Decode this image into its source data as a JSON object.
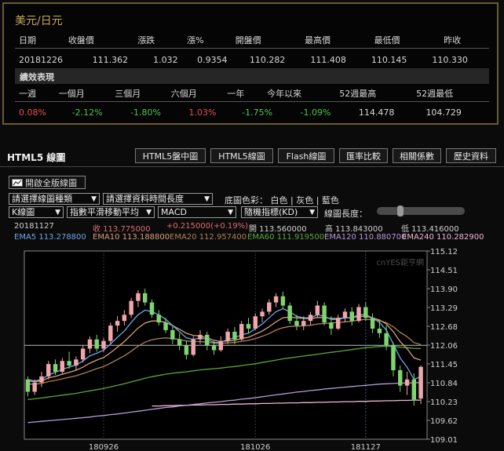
{
  "quote": {
    "title": "美元/日元",
    "headers": [
      "日期",
      "收盤價",
      "漲跌",
      "漲%",
      "開盤價",
      "最高價",
      "最低價",
      "昨收"
    ],
    "values": [
      "20181226",
      "111.362",
      "1.032",
      "0.9354",
      "110.282",
      "111.408",
      "110.145",
      "110.330"
    ],
    "perf_title": "績效表現",
    "perf_headers": [
      "一週",
      "一個月",
      "三個月",
      "六個月",
      "一年",
      "今年以來",
      "52週最高",
      "52週最低"
    ],
    "perf_values": [
      "0.08%",
      "-2.12%",
      "-1.80%",
      "1.03%",
      "-1.75%",
      "-1.09%",
      "114.478",
      "104.729"
    ]
  },
  "section": {
    "title": "HTML5 線圖",
    "tabs": [
      "HTML5盤中圖",
      "HTML5線圖",
      "Flash線圖",
      "匯率比較",
      "相關係數",
      "歷史資料"
    ]
  },
  "controls": {
    "full_button": "開啟全版線圖",
    "chart_type": "請選擇線圖種類",
    "time_length": "請選擇資料時間長度",
    "bg_label": "底圖色彩：",
    "bg_white": "白色",
    "bg_gray": "灰色",
    "bg_blue": "藍色",
    "sep": "|",
    "k_chart": "K線圖",
    "ma": "指數平滑移動平均",
    "macd": "MACD",
    "indicator": "隨機指標(KD)",
    "length_label": "線圖長度：",
    "length_level": 0.25
  },
  "info": {
    "date": "20181127",
    "close": "收 113.775000",
    "change": "+0.215000(+0.19%)",
    "open": "開 113.560000",
    "high": "高 113.843000",
    "low": "低 113.416000",
    "ema5": "EMA5 113.278800",
    "ema10": "EMA10 113.188800",
    "ema20": "EMA20 112.957400",
    "ema60": "EMA60 111.919500",
    "ema120": "EMA120 110.880700",
    "ema240": "EMA240 110.282900"
  },
  "chart_data": {
    "type": "candlestick",
    "watermark": "cnYES鉅亨網",
    "ylim": [
      109.01,
      115.12
    ],
    "y_ticks": [
      "115.12",
      "114.51",
      "113.90",
      "113.29",
      "112.68",
      "112.06",
      "111.45",
      "110.84",
      "110.23",
      "109.62",
      "109.01"
    ],
    "x_ticks": [
      "180926",
      "181026",
      "181127"
    ],
    "reference_line": 112.06,
    "colors": {
      "up": "#f0a6ab",
      "down": "#7fd46f",
      "ema5": "#6aa7e6",
      "ema10": "#d8a07a",
      "ema20": "#b07f56",
      "ema60": "#5aa63c",
      "ema120": "#b89ad8",
      "ema240": "#f2b8d6"
    },
    "candles": [
      [
        110.95,
        111.05,
        110.4,
        110.55
      ],
      [
        110.55,
        110.95,
        110.45,
        110.85
      ],
      [
        110.85,
        111.2,
        110.7,
        111.05
      ],
      [
        111.05,
        111.55,
        110.95,
        111.45
      ],
      [
        111.45,
        111.6,
        111.1,
        111.2
      ],
      [
        111.2,
        111.65,
        111.1,
        111.55
      ],
      [
        111.55,
        111.85,
        111.3,
        111.4
      ],
      [
        111.4,
        111.7,
        111.25,
        111.6
      ],
      [
        111.6,
        112.05,
        111.5,
        111.95
      ],
      [
        111.95,
        112.35,
        111.8,
        112.25
      ],
      [
        112.25,
        112.4,
        111.85,
        111.95
      ],
      [
        111.95,
        112.3,
        111.85,
        112.2
      ],
      [
        112.2,
        112.8,
        112.1,
        112.7
      ],
      [
        112.7,
        113.0,
        112.5,
        112.85
      ],
      [
        112.85,
        113.2,
        112.7,
        113.05
      ],
      [
        113.05,
        113.6,
        112.95,
        113.5
      ],
      [
        113.5,
        113.85,
        113.3,
        113.75
      ],
      [
        113.75,
        113.9,
        113.35,
        113.45
      ],
      [
        113.45,
        113.55,
        112.95,
        113.05
      ],
      [
        113.05,
        113.2,
        112.7,
        112.8
      ],
      [
        112.8,
        112.95,
        112.45,
        112.55
      ],
      [
        112.55,
        112.7,
        112.1,
        112.25
      ],
      [
        112.25,
        112.45,
        111.9,
        112.05
      ],
      [
        112.05,
        112.2,
        111.6,
        111.75
      ],
      [
        111.75,
        112.35,
        111.7,
        112.25
      ],
      [
        112.25,
        112.55,
        112.1,
        112.4
      ],
      [
        112.4,
        112.5,
        111.9,
        112.05
      ],
      [
        112.05,
        112.2,
        111.75,
        111.9
      ],
      [
        111.9,
        112.35,
        111.85,
        112.2
      ],
      [
        112.2,
        112.6,
        112.1,
        112.5
      ],
      [
        112.5,
        112.65,
        112.1,
        112.25
      ],
      [
        112.25,
        112.85,
        112.2,
        112.75
      ],
      [
        112.75,
        112.95,
        112.45,
        112.6
      ],
      [
        112.6,
        113.1,
        112.55,
        113.0
      ],
      [
        113.0,
        113.25,
        112.8,
        113.15
      ],
      [
        113.15,
        113.55,
        113.05,
        113.45
      ],
      [
        113.45,
        113.75,
        113.3,
        113.65
      ],
      [
        113.65,
        113.8,
        113.25,
        113.35
      ],
      [
        113.35,
        113.45,
        112.75,
        112.85
      ],
      [
        112.85,
        113.05,
        112.55,
        112.7
      ],
      [
        112.7,
        113.0,
        112.55,
        112.85
      ],
      [
        112.85,
        113.15,
        112.7,
        113.05
      ],
      [
        113.05,
        113.5,
        112.95,
        113.35
      ],
      [
        113.35,
        113.45,
        112.7,
        112.8
      ],
      [
        112.8,
        113.0,
        112.4,
        112.6
      ],
      [
        112.6,
        113.05,
        112.55,
        112.95
      ],
      [
        112.95,
        113.25,
        112.8,
        113.15
      ],
      [
        113.15,
        113.3,
        112.7,
        112.85
      ],
      [
        112.85,
        113.4,
        112.8,
        113.3
      ],
      [
        113.3,
        113.45,
        112.85,
        112.95
      ],
      [
        112.95,
        113.1,
        112.45,
        112.6
      ],
      [
        112.6,
        112.9,
        112.3,
        112.45
      ],
      [
        112.45,
        112.7,
        111.9,
        112.05
      ],
      [
        112.05,
        112.15,
        111.05,
        111.25
      ],
      [
        111.25,
        111.4,
        110.55,
        110.75
      ],
      [
        110.75,
        111.2,
        110.45,
        110.95
      ],
      [
        110.95,
        111.15,
        110.1,
        110.3
      ],
      [
        110.33,
        111.41,
        110.15,
        111.36
      ]
    ],
    "ema5": [
      110.95,
      110.9,
      110.95,
      111.1,
      111.18,
      111.28,
      111.35,
      111.42,
      111.55,
      111.72,
      111.8,
      111.9,
      112.1,
      112.32,
      112.52,
      112.8,
      113.05,
      113.2,
      113.15,
      113.05,
      112.9,
      112.7,
      112.5,
      112.3,
      112.25,
      112.3,
      112.25,
      112.15,
      112.15,
      112.25,
      112.3,
      112.4,
      112.45,
      112.6,
      112.75,
      112.95,
      113.15,
      113.25,
      113.15,
      113.0,
      112.95,
      112.95,
      113.05,
      113.0,
      112.9,
      112.9,
      112.95,
      112.95,
      113.05,
      113.05,
      112.95,
      112.8,
      112.55,
      112.1,
      111.65,
      111.35,
      110.95,
      111.05
    ],
    "ema10": [
      110.9,
      110.88,
      110.9,
      111.0,
      111.05,
      111.12,
      111.18,
      111.25,
      111.35,
      111.48,
      111.58,
      111.66,
      111.82,
      112.0,
      112.18,
      112.4,
      112.62,
      112.78,
      112.85,
      112.85,
      112.8,
      112.7,
      112.58,
      112.45,
      112.38,
      112.36,
      112.3,
      112.22,
      112.18,
      112.2,
      112.22,
      112.28,
      112.32,
      112.42,
      112.52,
      112.66,
      112.82,
      112.95,
      112.98,
      112.95,
      112.93,
      112.92,
      112.96,
      112.96,
      112.93,
      112.93,
      112.95,
      112.95,
      113.0,
      113.0,
      112.95,
      112.88,
      112.75,
      112.5,
      112.18,
      111.95,
      111.65,
      111.58
    ],
    "ema20": [
      110.8,
      110.8,
      110.82,
      110.88,
      110.92,
      110.97,
      111.02,
      111.07,
      111.14,
      111.22,
      111.3,
      111.37,
      111.48,
      111.6,
      111.72,
      111.87,
      112.03,
      112.16,
      112.24,
      112.28,
      112.3,
      112.28,
      112.25,
      112.2,
      112.18,
      112.18,
      112.16,
      112.13,
      112.12,
      112.14,
      112.15,
      112.19,
      112.22,
      112.28,
      112.35,
      112.44,
      112.55,
      112.63,
      112.67,
      112.68,
      112.69,
      112.71,
      112.75,
      112.77,
      112.78,
      112.8,
      112.82,
      112.84,
      112.88,
      112.9,
      112.89,
      112.86,
      112.79,
      112.66,
      112.48,
      112.34,
      112.15,
      112.08
    ],
    "ema60": [
      110.3,
      110.32,
      110.35,
      110.38,
      110.41,
      110.44,
      110.47,
      110.5,
      110.54,
      110.58,
      110.62,
      110.66,
      110.71,
      110.76,
      110.81,
      110.87,
      110.93,
      110.99,
      111.04,
      111.08,
      111.12,
      111.15,
      111.18,
      111.2,
      111.23,
      111.26,
      111.28,
      111.3,
      111.32,
      111.35,
      111.37,
      111.4,
      111.43,
      111.46,
      111.5,
      111.54,
      111.58,
      111.62,
      111.65,
      111.68,
      111.71,
      111.74,
      111.77,
      111.8,
      111.83,
      111.86,
      111.89,
      111.92,
      111.95,
      111.98,
      112.0,
      112.02,
      112.03,
      112.02,
      112.0,
      111.98,
      111.96,
      111.95
    ],
    "ema120": [
      109.55,
      109.57,
      109.59,
      109.61,
      109.63,
      109.65,
      109.67,
      109.69,
      109.71,
      109.73,
      109.76,
      109.78,
      109.81,
      109.83,
      109.86,
      109.89,
      109.92,
      109.95,
      109.98,
      110.01,
      110.04,
      110.06,
      110.09,
      110.11,
      110.14,
      110.16,
      110.19,
      110.21,
      110.23,
      110.26,
      110.28,
      110.31,
      110.33,
      110.36,
      110.39,
      110.42,
      110.45,
      110.48,
      110.51,
      110.54,
      110.56,
      110.59,
      110.61,
      110.64,
      110.66,
      110.68,
      110.7,
      110.72,
      110.74,
      110.76,
      110.78,
      110.8,
      110.81,
      110.82,
      110.83,
      110.84,
      110.84,
      110.85
    ],
    "ema240": [
      110.09,
      110.09,
      110.1,
      110.1,
      110.11,
      110.11,
      110.12,
      110.12,
      110.13,
      110.13,
      110.14,
      110.14,
      110.15,
      110.15,
      110.16,
      110.16,
      110.17,
      110.17,
      110.18,
      110.18,
      110.19,
      110.19,
      110.2,
      110.2,
      110.21,
      110.21,
      110.22,
      110.22,
      110.23,
      110.23,
      110.24,
      110.24,
      110.25,
      110.25,
      110.26,
      110.26,
      110.27,
      110.27,
      110.28,
      110.28
    ]
  }
}
